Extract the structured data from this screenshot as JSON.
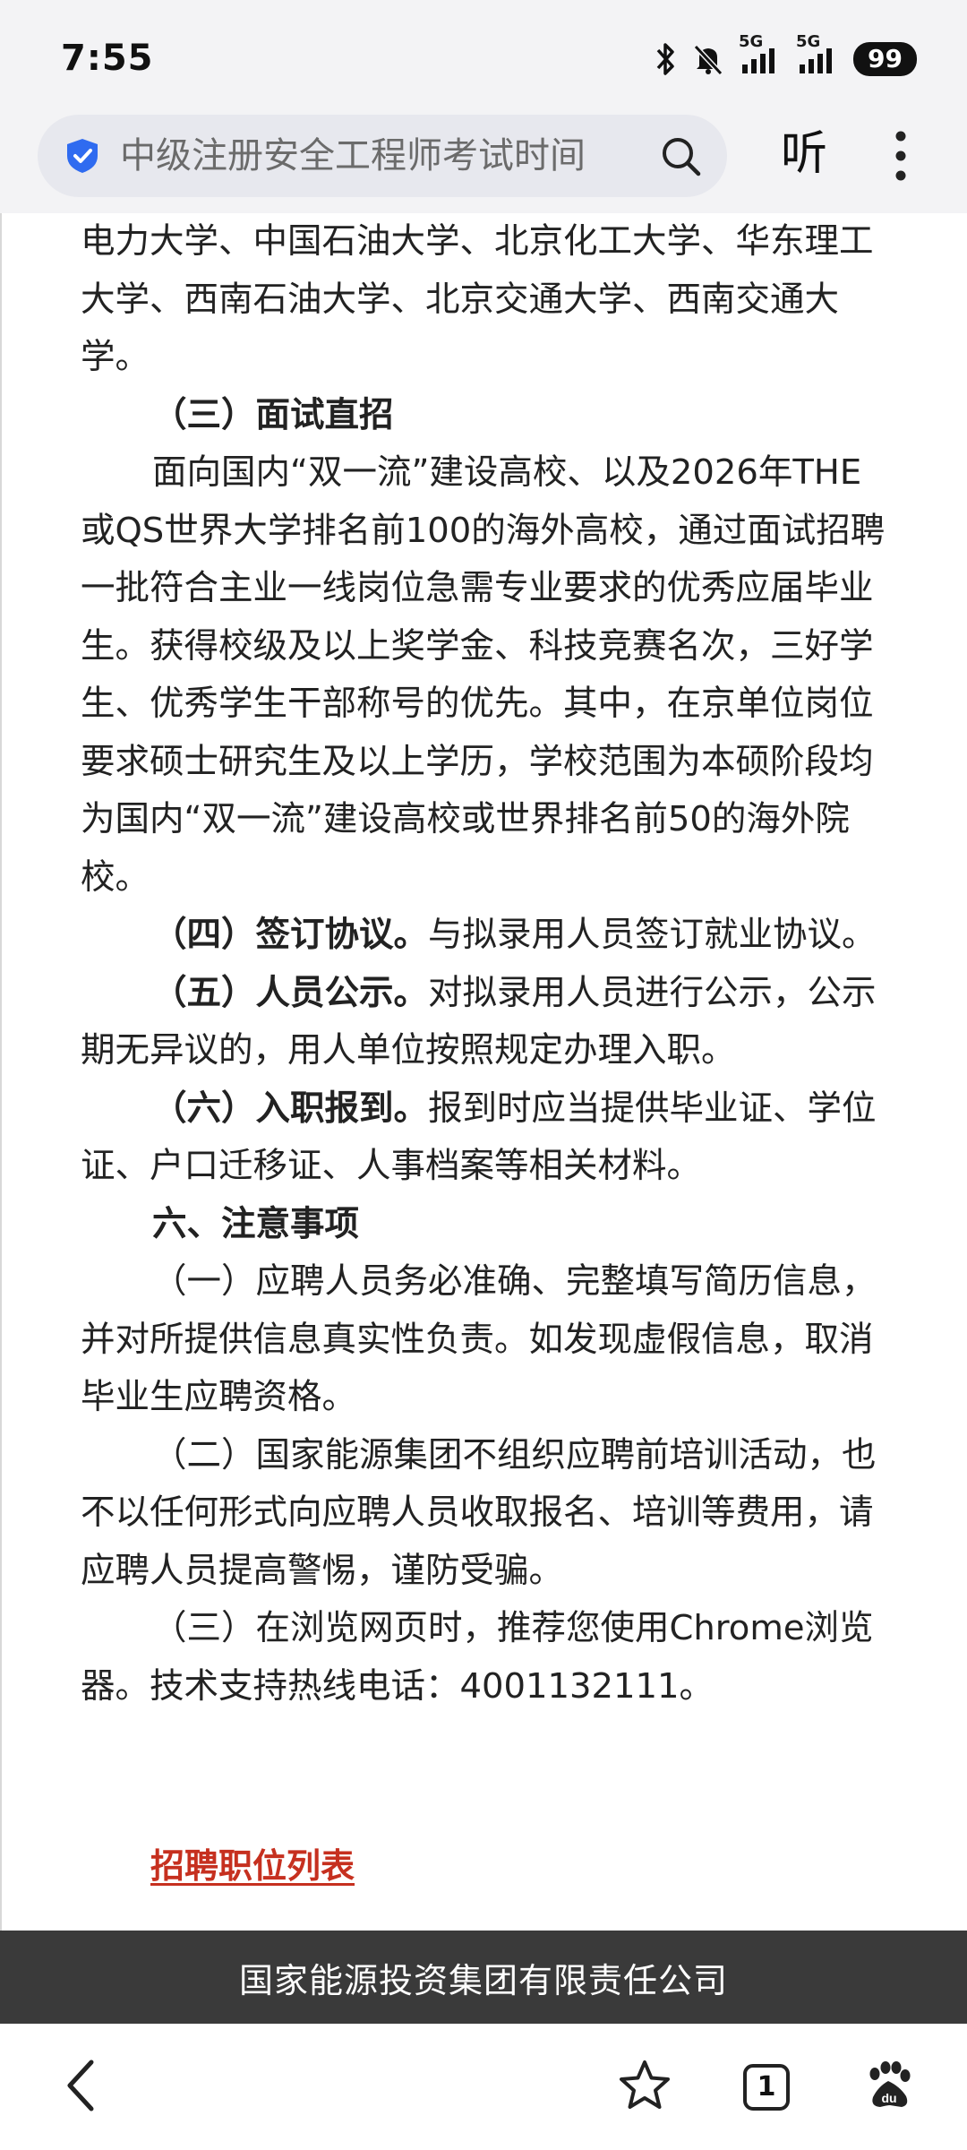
{
  "status_bar": {
    "time": "7:55",
    "network_1": "5G",
    "network_2": "5G",
    "battery": "99"
  },
  "top_bar": {
    "search_text": "中级注册安全工程师考试时间",
    "listen_label": "听"
  },
  "article": {
    "p1": "电力大学、中国石油大学、北京化工大学、华东理工大学、西南石油大学、北京交通大学、西南交通大学。",
    "h_interview": "（三）面试直招",
    "p_interview": "面向国内“双一流”建设高校、以及2026年THE或QS世界大学排名前100的海外高校，通过面试招聘一批符合主业一线岗位急需专业要求的优秀应届毕业生。获得校级及以上奖学金、科技竞赛名次，三好学生、优秀学生干部称号的优先。其中，在京单位岗位要求硕士研究生及以上学历，学校范围为本硕阶段均为国内“双一流”建设高校或世界排名前50的海外院校。",
    "h_sign": "（四）签订协议。",
    "t_sign": "与拟录用人员签订就业协议。",
    "h_publicity": "（五）人员公示。",
    "t_publicity": "对拟录用人员进行公示，公示期无异议的，用人单位按照规定办理入职。",
    "h_report": "（六）入职报到。",
    "t_report": "报到时应当提供毕业证、学位证、户口迁移证、人事档案等相关材料。",
    "h_notes": "六、注意事项",
    "n1": "（一）应聘人员务必准确、完整填写简历信息，并对所提供信息真实性负责。如发现虚假信息，取消毕业生应聘资格。",
    "n2": "（二）国家能源集团不组织应聘前培训活动，也不以任何形式向应聘人员收取报名、培训等费用，请应聘人员提高警惕，谨防受骗。",
    "n3": "（三）在浏览网页时，推荐您使用Chrome浏览器。技术支持热线电话：4001132111。"
  },
  "link": {
    "label": "招聘职位列表"
  },
  "footer": {
    "text": "国家能源投资集团有限责任公司"
  },
  "bottom_nav": {
    "tab_count": "1"
  },
  "colors": {
    "link": "#c6301f",
    "footer_bg": "#3a3a3a",
    "shield": "#2f6bf0",
    "browser_bar": "#f3f3f5"
  }
}
